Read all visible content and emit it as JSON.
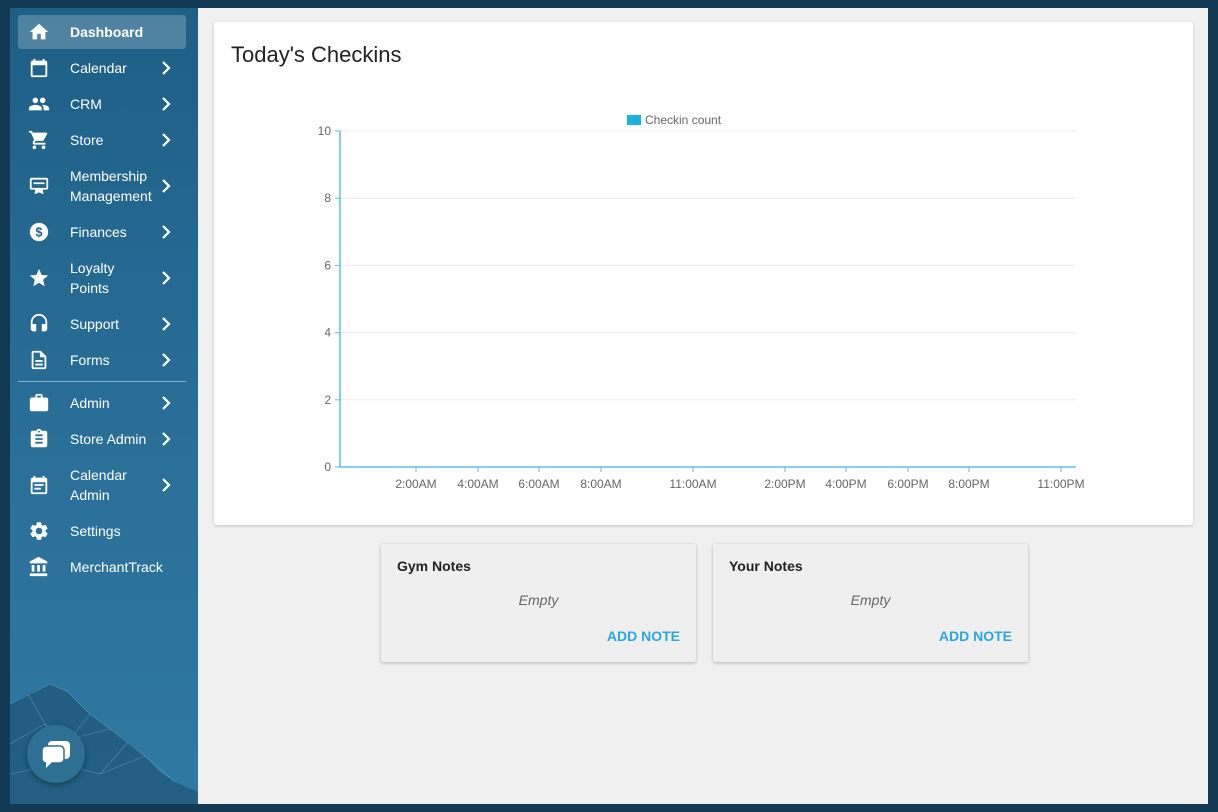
{
  "sidebar": {
    "items": [
      {
        "label": "Dashboard",
        "icon": "home-icon",
        "chevron": false,
        "active": true
      },
      {
        "label": "Calendar",
        "icon": "calendar-icon",
        "chevron": true
      },
      {
        "label": "CRM",
        "icon": "people-icon",
        "chevron": true
      },
      {
        "label": "Store",
        "icon": "cart-icon",
        "chevron": true
      },
      {
        "label": "Membership Management",
        "icon": "membership-card-icon",
        "chevron": true
      },
      {
        "label": "Finances",
        "icon": "dollar-circle-icon",
        "chevron": true
      },
      {
        "label": "Loyalty Points",
        "icon": "star-icon",
        "chevron": true
      },
      {
        "label": "Support",
        "icon": "headset-icon",
        "chevron": true
      },
      {
        "label": "Forms",
        "icon": "document-icon",
        "chevron": true
      },
      {
        "label": "Admin",
        "icon": "briefcase-icon",
        "chevron": true
      },
      {
        "label": "Store Admin",
        "icon": "clipboard-icon",
        "chevron": true
      },
      {
        "label": "Calendar Admin",
        "icon": "calendar-list-icon",
        "chevron": true
      },
      {
        "label": "Settings",
        "icon": "gear-icon",
        "chevron": false
      },
      {
        "label": "MerchantTrack",
        "icon": "bank-icon",
        "chevron": false
      }
    ]
  },
  "chart": {
    "title": "Today's Checkins"
  },
  "chart_data": {
    "type": "bar",
    "title": "Today's Checkins",
    "legend": {
      "position": "top-center",
      "entries": [
        "Checkin count"
      ]
    },
    "series": [
      {
        "name": "Checkin count",
        "color": "#1ab0e0",
        "values": [
          0,
          0,
          0,
          0,
          0,
          0,
          0,
          0,
          0,
          0
        ]
      }
    ],
    "categories": [
      "2:00AM",
      "4:00AM",
      "6:00AM",
      "8:00AM",
      "11:00AM",
      "2:00PM",
      "4:00PM",
      "6:00PM",
      "8:00PM",
      "11:00PM"
    ],
    "yticks": [
      "0",
      "2",
      "4",
      "6",
      "8",
      "10"
    ],
    "ylim": [
      0,
      10
    ],
    "grid": true,
    "axis_color": "#5bbde8"
  },
  "notes": {
    "gym": {
      "title": "Gym Notes",
      "empty": "Empty",
      "action": "ADD NOTE"
    },
    "yours": {
      "title": "Your Notes",
      "empty": "Empty",
      "action": "ADD NOTE"
    }
  },
  "colors": {
    "accent": "#2aa6e0",
    "sidebar": "#1e5f86"
  }
}
